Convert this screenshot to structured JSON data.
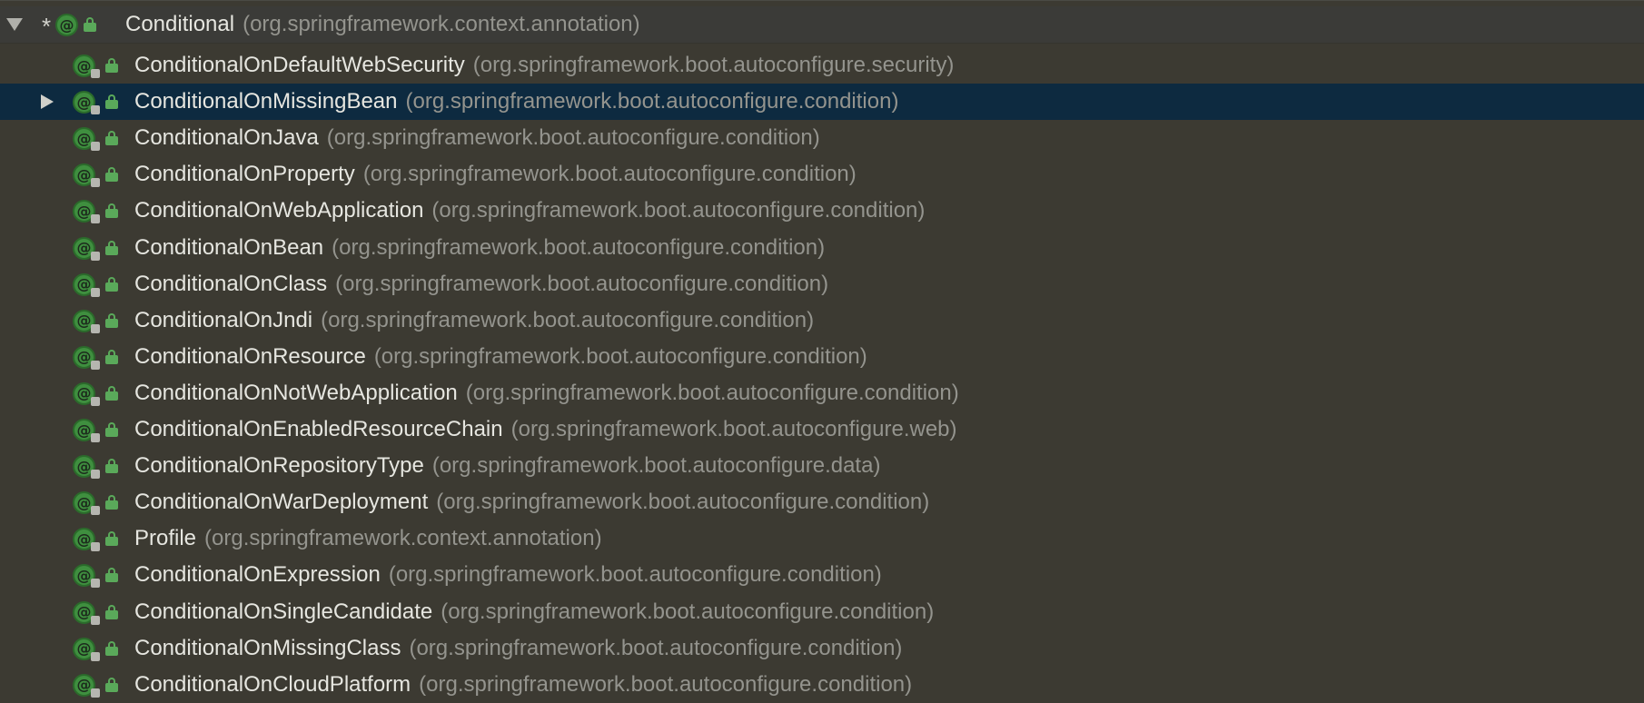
{
  "root": {
    "name": "Conditional",
    "package": "(org.springframework.context.annotation)",
    "star": "*",
    "expanded": true
  },
  "items": [
    {
      "name": "ConditionalOnDefaultWebSecurity",
      "package": "(org.springframework.boot.autoconfigure.security)",
      "selected": false,
      "expandable": false
    },
    {
      "name": "ConditionalOnMissingBean",
      "package": "(org.springframework.boot.autoconfigure.condition)",
      "selected": true,
      "expandable": true
    },
    {
      "name": "ConditionalOnJava",
      "package": "(org.springframework.boot.autoconfigure.condition)",
      "selected": false,
      "expandable": false
    },
    {
      "name": "ConditionalOnProperty",
      "package": "(org.springframework.boot.autoconfigure.condition)",
      "selected": false,
      "expandable": false
    },
    {
      "name": "ConditionalOnWebApplication",
      "package": "(org.springframework.boot.autoconfigure.condition)",
      "selected": false,
      "expandable": false
    },
    {
      "name": "ConditionalOnBean",
      "package": "(org.springframework.boot.autoconfigure.condition)",
      "selected": false,
      "expandable": false
    },
    {
      "name": "ConditionalOnClass",
      "package": "(org.springframework.boot.autoconfigure.condition)",
      "selected": false,
      "expandable": false
    },
    {
      "name": "ConditionalOnJndi",
      "package": "(org.springframework.boot.autoconfigure.condition)",
      "selected": false,
      "expandable": false
    },
    {
      "name": "ConditionalOnResource",
      "package": "(org.springframework.boot.autoconfigure.condition)",
      "selected": false,
      "expandable": false
    },
    {
      "name": "ConditionalOnNotWebApplication",
      "package": "(org.springframework.boot.autoconfigure.condition)",
      "selected": false,
      "expandable": false
    },
    {
      "name": "ConditionalOnEnabledResourceChain",
      "package": "(org.springframework.boot.autoconfigure.web)",
      "selected": false,
      "expandable": false
    },
    {
      "name": "ConditionalOnRepositoryType",
      "package": "(org.springframework.boot.autoconfigure.data)",
      "selected": false,
      "expandable": false
    },
    {
      "name": "ConditionalOnWarDeployment",
      "package": "(org.springframework.boot.autoconfigure.condition)",
      "selected": false,
      "expandable": false
    },
    {
      "name": "Profile",
      "package": "(org.springframework.context.annotation)",
      "selected": false,
      "expandable": false
    },
    {
      "name": "ConditionalOnExpression",
      "package": "(org.springframework.boot.autoconfigure.condition)",
      "selected": false,
      "expandable": false
    },
    {
      "name": "ConditionalOnSingleCandidate",
      "package": "(org.springframework.boot.autoconfigure.condition)",
      "selected": false,
      "expandable": false
    },
    {
      "name": "ConditionalOnMissingClass",
      "package": "(org.springframework.boot.autoconfigure.condition)",
      "selected": false,
      "expandable": false
    },
    {
      "name": "ConditionalOnCloudPlatform",
      "package": "(org.springframework.boot.autoconfigure.condition)",
      "selected": false,
      "expandable": false
    }
  ],
  "icons": {
    "annotation": "annotation-icon",
    "lock": "lock-icon",
    "expanded_arrow": "chevron-down-icon",
    "collapsed_arrow": "chevron-right-icon"
  },
  "colors": {
    "background": "#3c3a32",
    "selected_row": "#0d2a40",
    "annotation_badge": "#3f8f3f",
    "name_text": "#e6e6e0",
    "package_text": "#94948e"
  }
}
